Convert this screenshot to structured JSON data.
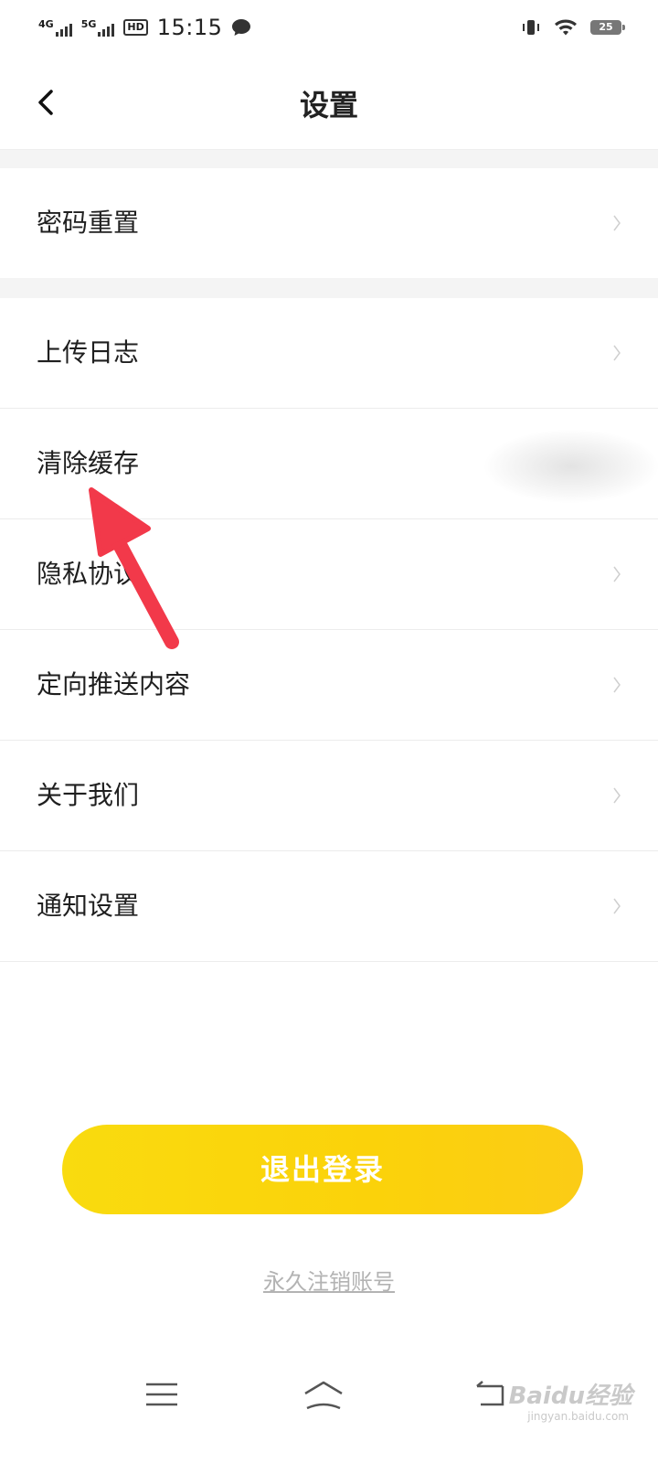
{
  "status_bar": {
    "network_1": "4G",
    "network_2": "5G",
    "hd_badge": "HD",
    "time": "15:15",
    "battery": "25"
  },
  "header": {
    "title": "设置"
  },
  "settings": {
    "reset_password": "密码重置",
    "items": [
      "上传日志",
      "清除缓存",
      "隐私协议",
      "定向推送内容",
      "关于我们",
      "通知设置"
    ]
  },
  "actions": {
    "logout": "退出登录",
    "delete_account": "永久注销账号"
  },
  "watermark": {
    "brand": "Baidu经验",
    "url": "jingyan.baidu.com"
  },
  "colors": {
    "accent": "#fbd20a",
    "annotation_arrow": "#f2394a"
  }
}
